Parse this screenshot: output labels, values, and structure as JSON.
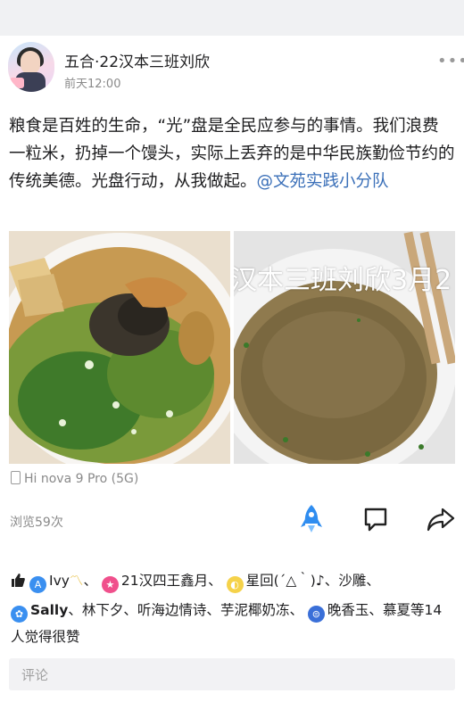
{
  "post": {
    "author": "五合·22汉本三班刘欣",
    "time": "前天12:00",
    "text_main": "粮食是百姓的生命，“光”盘是全民应参与的事情。我们浪费一粒米，扔掉一个馒头，实际上丢弃的是中华民族勤俭节约的传统美德。光盘行动，从我做起。",
    "mention": "@文苑实践小分队",
    "photo_caption": "汉本三班刘欣3月2",
    "device": "Hi nova 9 Pro (5G)",
    "views": "浏览59次"
  },
  "likes": {
    "names": [
      "Ivy",
      "21汉四王鑫月",
      "星回(´△｀)♪",
      "沙雕",
      "Sally",
      "林下夕",
      "听海边情诗",
      "芋泥椰奶冻",
      "晚香玉",
      "慕夏"
    ],
    "seps": [
      "、",
      "、",
      "、",
      "、",
      "、",
      "、",
      "、",
      "、",
      "、"
    ],
    "suffix": "等14人觉得很赞"
  },
  "comment": {
    "placeholder": "评论"
  },
  "icons": [
    "more-icon",
    "phone-icon",
    "rocket-icon",
    "comment-icon",
    "share-icon",
    "thumb-up-icon"
  ],
  "colors": {
    "link": "#3a6fb8",
    "rocket": "#2f8df0",
    "badge_blue": "#3a8ff0",
    "badge_pink": "#f0508c",
    "badge_yellow": "#f5d24a"
  }
}
